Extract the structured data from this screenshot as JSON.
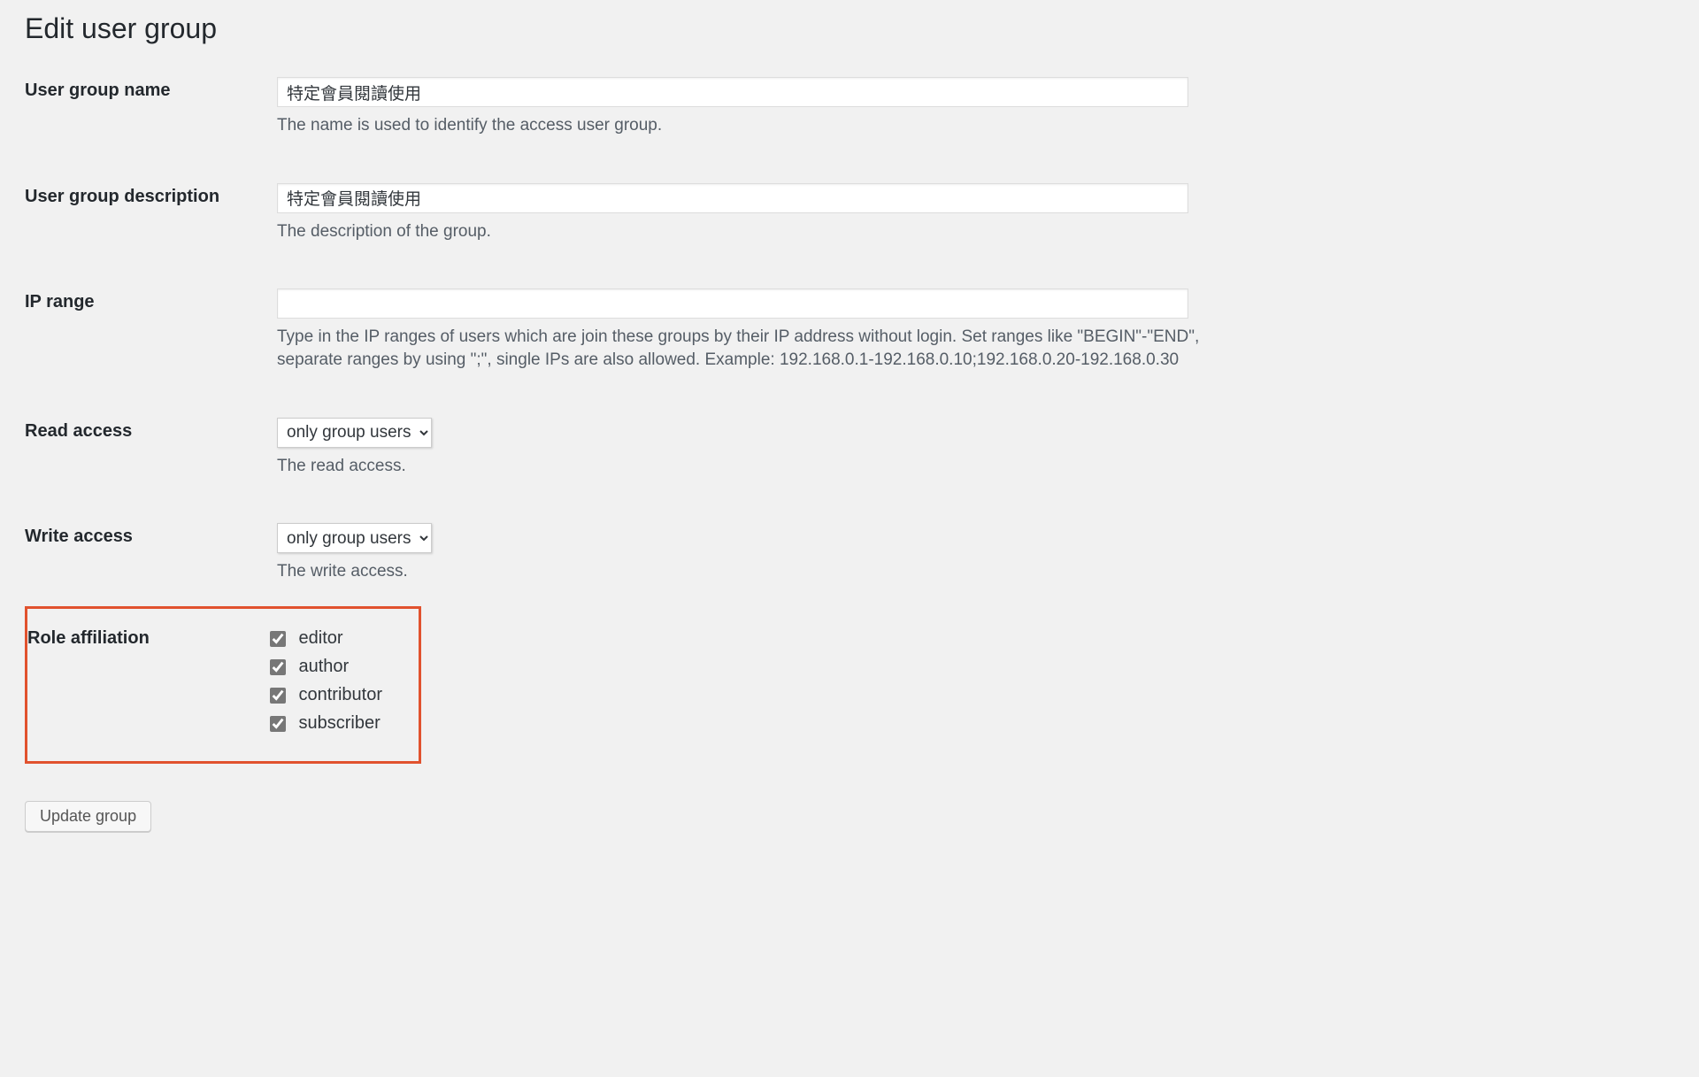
{
  "page": {
    "title": "Edit user group"
  },
  "fields": {
    "name": {
      "label": "User group name",
      "value": "特定會員閱讀使用",
      "desc": "The name is used to identify the access user group."
    },
    "description": {
      "label": "User group description",
      "value": "特定會員閱讀使用",
      "desc": "The description of the group."
    },
    "ip_range": {
      "label": "IP range",
      "value": "",
      "desc": "Type in the IP ranges of users which are join these groups by their IP address without login. Set ranges like \"BEGIN\"-\"END\", separate ranges by using \";\", single IPs are also allowed. Example: 192.168.0.1-192.168.0.10;192.168.0.20-192.168.0.30"
    },
    "read_access": {
      "label": "Read access",
      "selected": "only group users",
      "desc": "The read access."
    },
    "write_access": {
      "label": "Write access",
      "selected": "only group users",
      "desc": "The write access."
    },
    "roles": {
      "label": "Role affiliation",
      "items": [
        {
          "label": "editor",
          "checked": true
        },
        {
          "label": "author",
          "checked": true
        },
        {
          "label": "contributor",
          "checked": true
        },
        {
          "label": "subscriber",
          "checked": true
        }
      ]
    }
  },
  "actions": {
    "submit_label": "Update group"
  }
}
